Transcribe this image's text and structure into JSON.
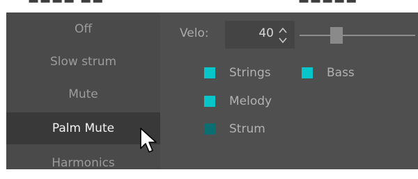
{
  "mode_menu": {
    "items": [
      {
        "label": "Off",
        "selected": false
      },
      {
        "label": "Slow strum",
        "selected": false
      },
      {
        "label": "Mute",
        "selected": false
      },
      {
        "label": "Palm Mute",
        "selected": true
      },
      {
        "label": "Harmonics",
        "selected": false
      }
    ]
  },
  "velocity": {
    "label": "Velo:",
    "value": "40"
  },
  "targets": {
    "strings": {
      "label": "Strings",
      "checked": true
    },
    "bass": {
      "label": "Bass",
      "checked": true
    },
    "melody": {
      "label": "Melody",
      "checked": true
    },
    "strum": {
      "label": "Strum",
      "checked": false
    }
  },
  "colors": {
    "panel_bg": "#4f4f4f",
    "menu_bg": "#4a4a4a",
    "menu_selected_bg": "#393939",
    "accent_checked": "#06c6c9",
    "accent_unchecked": "#0b6f71"
  }
}
